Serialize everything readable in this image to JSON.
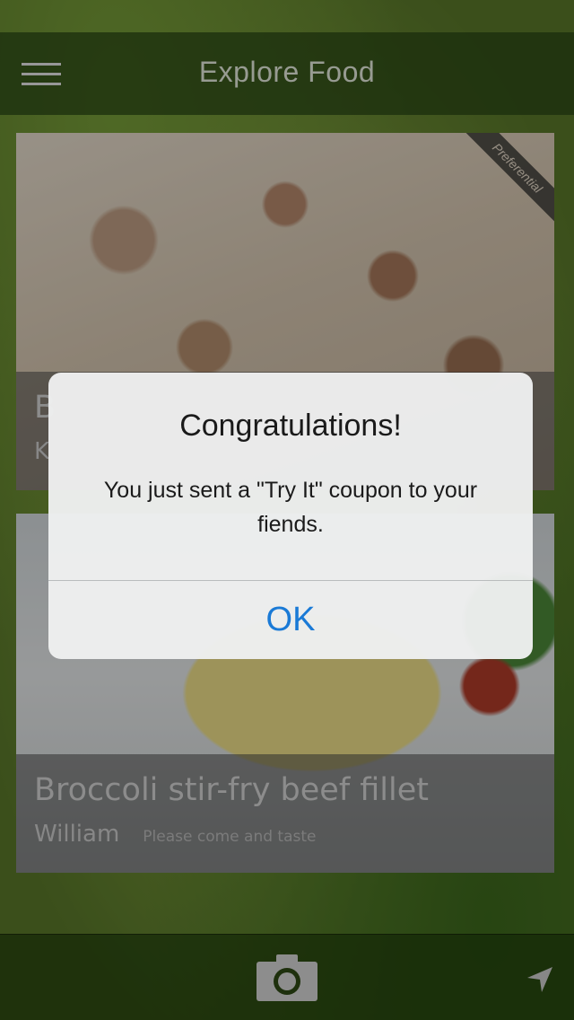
{
  "header": {
    "title": "Explore Food",
    "menu_icon": "hamburger-menu-icon"
  },
  "feed": {
    "cards": [
      {
        "title": "B",
        "author": "K",
        "note": "",
        "ribbon": "Preferential"
      },
      {
        "title": "Broccoli stir-fry beef fillet",
        "author": "William",
        "note": "Please come and taste"
      }
    ]
  },
  "tab_bar": {
    "camera_icon": "camera-icon",
    "location_icon": "location-arrow-icon"
  },
  "alert": {
    "title": "Congratulations!",
    "message": "You just sent a \"Try It\" coupon to your fiends.",
    "ok_label": "OK"
  },
  "colors": {
    "accent": "#1a7ad6",
    "nav_background": "#28461a",
    "alert_background": "#eef0f0"
  }
}
